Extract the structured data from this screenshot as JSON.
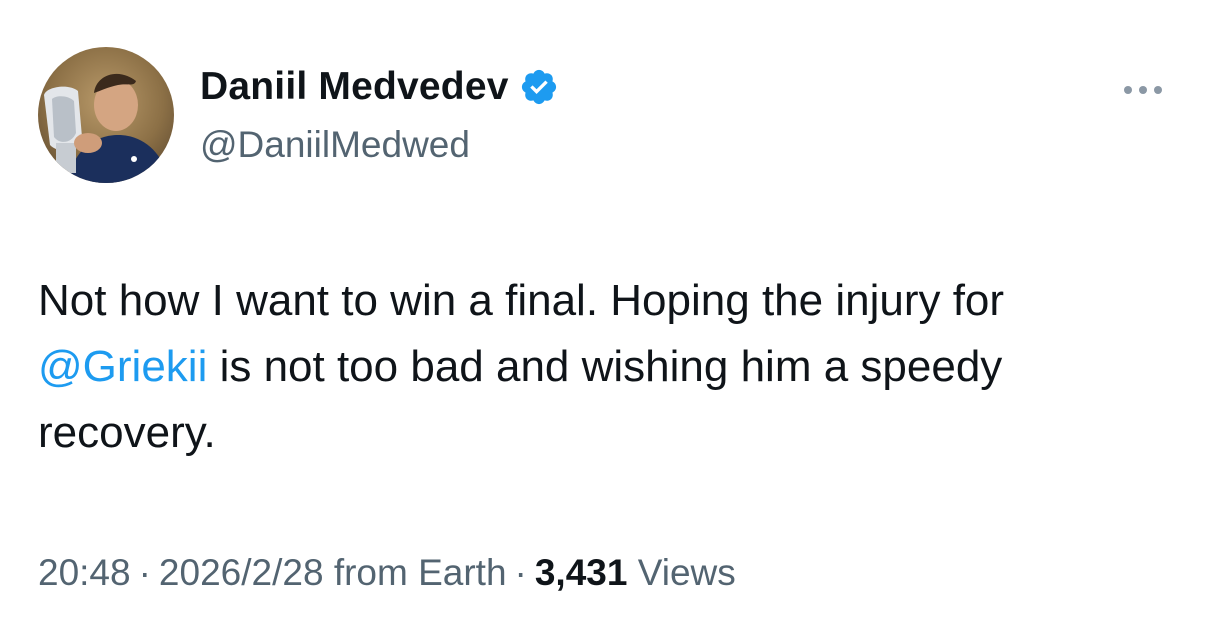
{
  "author": {
    "display_name": "Daniil Medvedev",
    "handle": "@DaniilMedwed",
    "verified": true
  },
  "tweet": {
    "text_part1": "Not how I want to win a final.  Hoping the injury for ",
    "mention": "@Griekii",
    "text_part2": " is not too bad and wishing him a speedy recovery."
  },
  "meta": {
    "time": "20:48",
    "separator": "·",
    "date": "2026/2/28",
    "source": "from Earth",
    "views_count": "3,431",
    "views_label": "Views"
  },
  "icons": {
    "verified": "verified-badge-icon",
    "more": "more-options-icon"
  },
  "colors": {
    "verified_blue": "#1d9bf0",
    "mention_blue": "#1d9bf0",
    "secondary_text": "#536471",
    "primary_text": "#0f1419"
  }
}
